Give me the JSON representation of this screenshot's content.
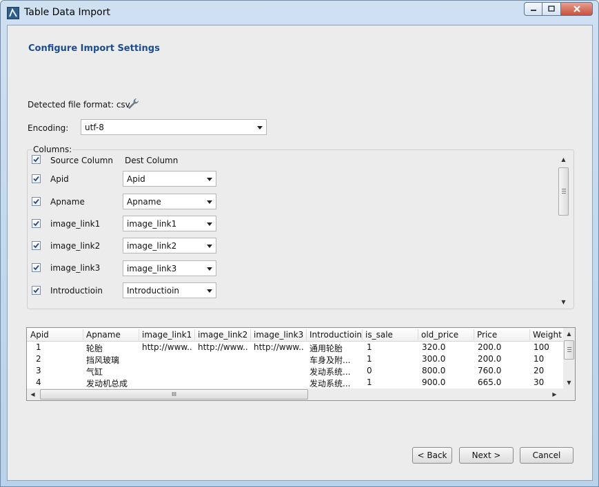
{
  "window": {
    "title": "Table Data Import"
  },
  "page": {
    "heading": "Configure Import Settings"
  },
  "file_format": {
    "label": "Detected file format:",
    "value": "csv"
  },
  "encoding": {
    "label": "Encoding:",
    "value": "utf-8"
  },
  "columns": {
    "group_label": "Columns:",
    "header": {
      "source": "Source Column",
      "dest": "Dest Column"
    },
    "rows": [
      {
        "source": "Apid",
        "dest": "Apid"
      },
      {
        "source": "Apname",
        "dest": "Apname"
      },
      {
        "source": "image_link1",
        "dest": "image_link1"
      },
      {
        "source": "image_link2",
        "dest": "image_link2"
      },
      {
        "source": "image_link3",
        "dest": "image_link3"
      },
      {
        "source": "Introductioin",
        "dest": "Introductioin"
      }
    ]
  },
  "preview": {
    "columns": [
      "Apid",
      "Apname",
      "image_link1",
      "image_link2",
      "image_link3",
      "Introductioin",
      "is_sale",
      "old_price",
      "Price",
      "Weight"
    ],
    "rows": [
      [
        "1",
        "轮胎",
        "http://www...",
        "http://www...",
        "http://www...",
        "通用轮胎",
        "1",
        "320.0",
        "200.0",
        "100"
      ],
      [
        "2",
        "挡风玻璃",
        "",
        "",
        "",
        "车身及附...",
        "1",
        "300.0",
        "200.0",
        "10"
      ],
      [
        "3",
        "气缸",
        "",
        "",
        "",
        "发动系统...",
        "0",
        "800.0",
        "760.0",
        "20"
      ],
      [
        "4",
        "发动机总成",
        "",
        "",
        "",
        "发动系统...",
        "1",
        "900.0",
        "665.0",
        "30"
      ]
    ]
  },
  "buttons": {
    "back": "< Back",
    "next": "Next >",
    "cancel": "Cancel"
  }
}
